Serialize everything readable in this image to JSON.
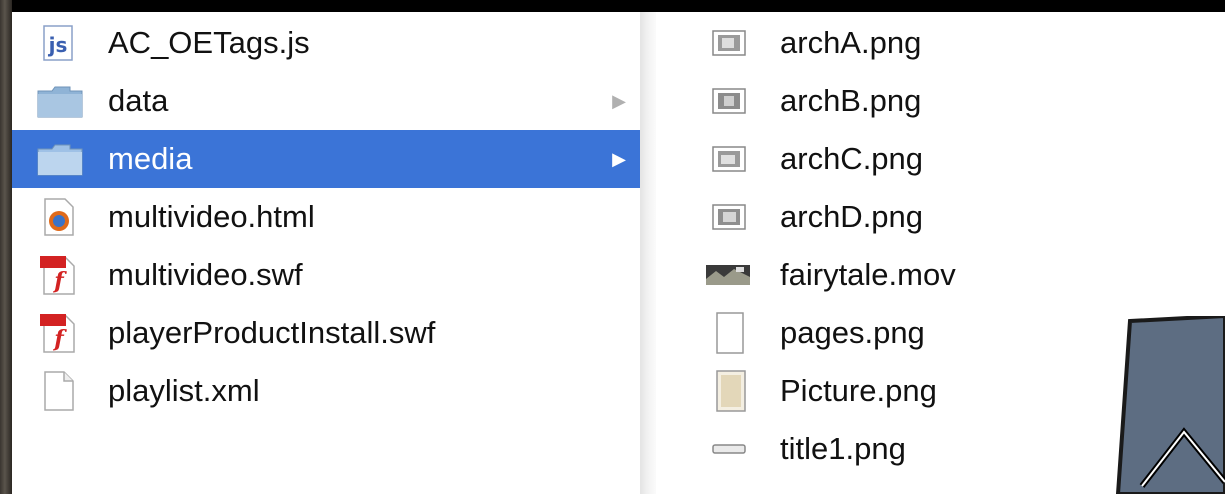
{
  "left_column": {
    "items": [
      {
        "name": "AC_OETags.js",
        "icon": "js-file-icon"
      },
      {
        "name": "data",
        "icon": "folder-icon",
        "chevron": "▶"
      },
      {
        "name": "media",
        "icon": "folder-icon",
        "chevron": "▶",
        "selected": true
      },
      {
        "name": "multivideo.html",
        "icon": "html-file-icon"
      },
      {
        "name": "multivideo.swf",
        "icon": "flash-file-icon"
      },
      {
        "name": "playerProductInstall.swf",
        "icon": "flash-file-icon"
      },
      {
        "name": "playlist.xml",
        "icon": "document-icon"
      }
    ]
  },
  "right_column": {
    "items": [
      {
        "name": "archA.png",
        "icon": "image-thumbnail-icon"
      },
      {
        "name": "archB.png",
        "icon": "image-thumbnail-icon"
      },
      {
        "name": "archC.png",
        "icon": "image-thumbnail-icon"
      },
      {
        "name": "archD.png",
        "icon": "image-thumbnail-icon"
      },
      {
        "name": "fairytale.mov",
        "icon": "movie-thumbnail-icon"
      },
      {
        "name": "pages.png",
        "icon": "blank-page-icon"
      },
      {
        "name": "Picture.png",
        "icon": "picture-thumbnail-icon"
      },
      {
        "name": "title1.png",
        "icon": "thin-bar-thumbnail-icon"
      }
    ]
  },
  "colors": {
    "selection": "#3b74d7",
    "callout_fill": "#5d6d82",
    "background": "#000000"
  },
  "callout": {
    "icon": "pointer-arrow-callout-icon"
  }
}
